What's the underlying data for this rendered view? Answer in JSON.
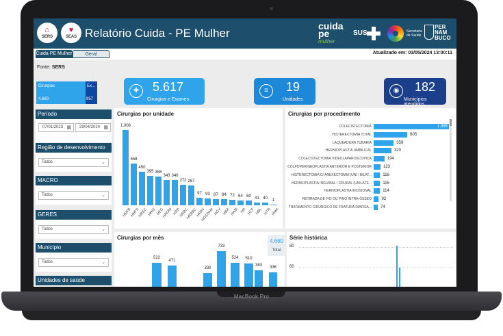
{
  "header": {
    "title": "Relatório Cuida - PE Mulher",
    "logo_left_1": "SERS",
    "logo_left_2": "SEAS",
    "brand_cuida": "cuida",
    "brand_pe": "pe",
    "brand_mulher": "mulher",
    "sus": "SUS",
    "secretaria": "Secretaria de Saúde",
    "pernambuco": "PER NAM BUCO"
  },
  "tabs": [
    {
      "label": "Cuida PE Mulher",
      "active": true
    },
    {
      "label": "Geral",
      "active": false
    }
  ],
  "updated": "Atualizado em: 03/05/2024 13:00:11",
  "fonte": {
    "label": "Fonte:",
    "value": "SERS"
  },
  "cirurgias_card": {
    "label": "Cirurgias",
    "value": "4.660",
    "side_label": "Ex...",
    "side_value": "957"
  },
  "kpis": [
    {
      "number": "5.617",
      "caption": "Cirurgias e Exames",
      "icon": "clipboard-icon",
      "color": "#2fa4ea"
    },
    {
      "number": "19",
      "caption": "Unidades",
      "icon": "document-icon",
      "color": "#1e88d8"
    },
    {
      "number": "182",
      "caption": "Municípios atendidos",
      "icon": "location-pin-icon",
      "color": "#1c3f8c"
    }
  ],
  "filters": {
    "periodo": {
      "label": "Período",
      "start": "07/01/2023",
      "end": "29/04/2024"
    },
    "regiao": {
      "label": "Região de desenvolvimento",
      "value": "Todos"
    },
    "macro": {
      "label": "MACRO",
      "value": "Todos"
    },
    "geres": {
      "label": "GERES",
      "value": "Todos"
    },
    "municipio": {
      "label": "Município",
      "value": "Todos"
    },
    "unidades": {
      "label": "Unidades de saúde"
    }
  },
  "panels": {
    "por_unidade": "Cirurgias por unidade",
    "por_procedimento": "Cirurgias por procedimento",
    "por_mes": "Cirurgias por mês",
    "serie": "Série histórica",
    "total_value": "4.660",
    "total_label": "Total"
  },
  "chart_data": [
    {
      "type": "bar",
      "title": "Cirurgias por unidade",
      "categories": [
        "HRFB",
        "HRFS",
        "HREC",
        "HRIS",
        "HEC",
        "HROM",
        "HRP",
        "HRBC",
        "HRBBC",
        "HRAV",
        "HOSPAM",
        "HGV",
        "HBA",
        "HAM",
        "HR",
        "HCF",
        "HBL",
        "HTR",
        "HMA"
      ],
      "values": [
        1008,
        558,
        450,
        395,
        388,
        343,
        340,
        272,
        267,
        97,
        93,
        87,
        84,
        72,
        64,
        60,
        41,
        40,
        1
      ],
      "labels": [
        "1.008",
        "558",
        "450",
        "395",
        "388",
        "343",
        "340",
        "272",
        "267",
        "97",
        "93",
        "87",
        "84",
        "72",
        "64",
        "60",
        "41",
        "40",
        "1"
      ],
      "max": 1008
    },
    {
      "type": "bar",
      "orientation": "horizontal",
      "title": "Cirurgias por procedimento",
      "categories": [
        "COLECISTECTOMIA",
        "HISTERECTOMIA TOTAL",
        "LAQUEADURA TUBARIA",
        "HERNIOPLASTIA UMBILICAL",
        "COLECISTECTOMIA VIDEOLAPAROSCOPICA",
        "COLPOPERINEOPLASTIA ANTERIOR E POSTERIOR",
        "HISTERECTOMIA C/ ANEXECTOMIA (UNI / BILAT...",
        "HERNIOPLASTIA INGUINAL / CRURAL (UNILATE...",
        "HERNIOPLASTIA INCISIONAL",
        "RETIRADA DE FIO OU PINO INTRA-ÓSSEO",
        "TRATAMENTO CIRÚRGICO DE FRATURA DIAFISA..."
      ],
      "values": [
        1355,
        605,
        359,
        320,
        194,
        123,
        116,
        115,
        114,
        92,
        74
      ],
      "labels": [
        "1.355",
        "605",
        "359",
        "320",
        "194",
        "123",
        "116",
        "115",
        "114",
        "92",
        "74"
      ],
      "max": 1355
    },
    {
      "type": "bar",
      "title": "Cirurgias por mês",
      "values": [
        522,
        471,
        330,
        733,
        524,
        510,
        383,
        336
      ],
      "labels": [
        "522",
        "471",
        "330",
        "733",
        "524",
        "510",
        "383",
        "336"
      ],
      "max": 733
    },
    {
      "type": "line",
      "title": "Série histórica",
      "yticks": [
        "80",
        "60"
      ],
      "ylim": [
        0,
        80
      ]
    }
  ]
}
